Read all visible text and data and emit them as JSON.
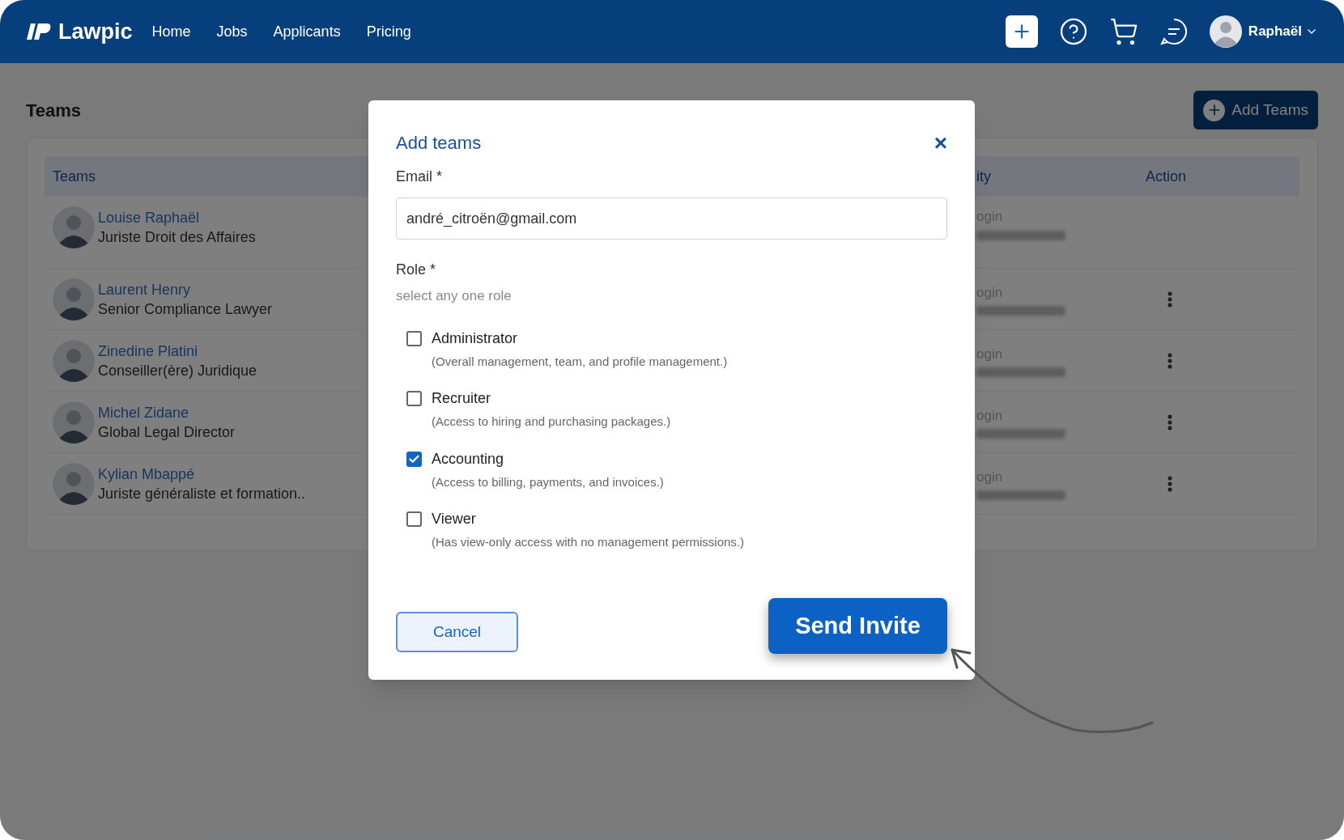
{
  "nav": {
    "logo": "Lawpic",
    "links": [
      {
        "label": "Home"
      },
      {
        "label": "Jobs"
      },
      {
        "label": "Applicants"
      },
      {
        "label": "Pricing"
      }
    ],
    "user": "Raphaël"
  },
  "page": {
    "title": "Teams",
    "add_button": "Add Teams"
  },
  "table": {
    "columns": [
      "Teams",
      "ity",
      "Action"
    ],
    "rows": [
      {
        "name": "Louise Raphaël",
        "role": "Juriste Droit des Affaires",
        "column_2": "ogin",
        "has_menu": false
      },
      {
        "name": "Laurent Henry",
        "role": "Senior Compliance Lawyer",
        "column_2": "ogin",
        "has_menu": true
      },
      {
        "name": "Zinedine Platini",
        "role": "Conseiller(ère) Juridique",
        "column_2": "ogin",
        "has_menu": true
      },
      {
        "name": "Michel Zidane",
        "role": "Global Legal Director",
        "column_2": "ogin",
        "has_menu": true
      },
      {
        "name": "Kylian Mbappé",
        "role": "Juriste généraliste et formation..",
        "column_2": "ogin",
        "has_menu": true
      }
    ]
  },
  "modal": {
    "title": "Add teams",
    "close": "×",
    "email_label": "Email *",
    "email_value": "andré_citroën@gmail.com",
    "role_label": "Role *",
    "role_hint": "select any one role",
    "roles": [
      {
        "label": "Administrator",
        "description": "(Overall management, team, and profile management.)",
        "checked": false
      },
      {
        "label": "Recruiter",
        "description": "(Access to hiring and purchasing packages.)",
        "checked": false
      },
      {
        "label": "Accounting",
        "description": "(Access to billing, payments, and invoices.)",
        "checked": true
      },
      {
        "label": "Viewer",
        "description": "(Has view-only access with no management permissions.)",
        "checked": false
      }
    ],
    "cancel": "Cancel",
    "submit": "Send Invite"
  }
}
